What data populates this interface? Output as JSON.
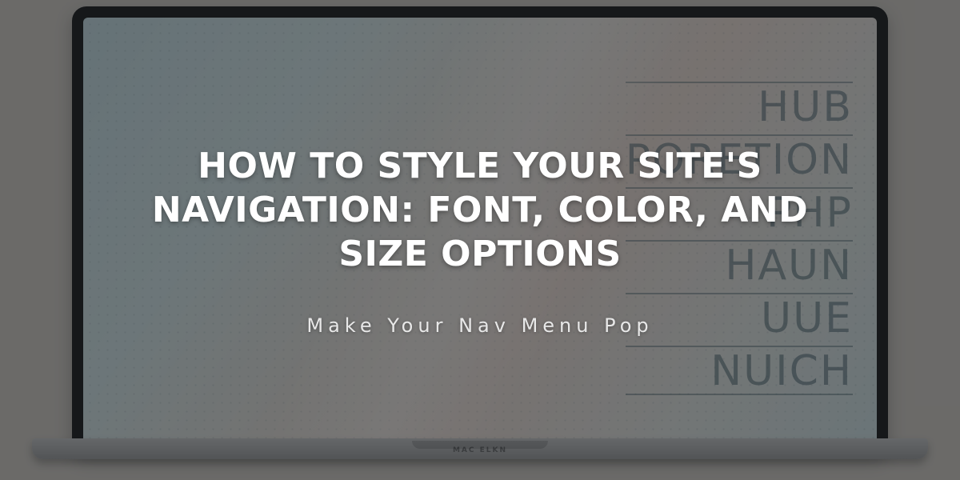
{
  "hero": {
    "title": "HOW TO STYLE YOUR SITE'S NAVIGATION: FONT, COLOR, AND SIZE OPTIONS",
    "subtitle": "Make Your Nav Menu Pop"
  },
  "decor": {
    "wordstack": [
      "HUB",
      "PORETION",
      "PHP",
      "HAUN",
      "UUE",
      "NUICH"
    ],
    "laptop_brand": "MAC ELKN"
  }
}
